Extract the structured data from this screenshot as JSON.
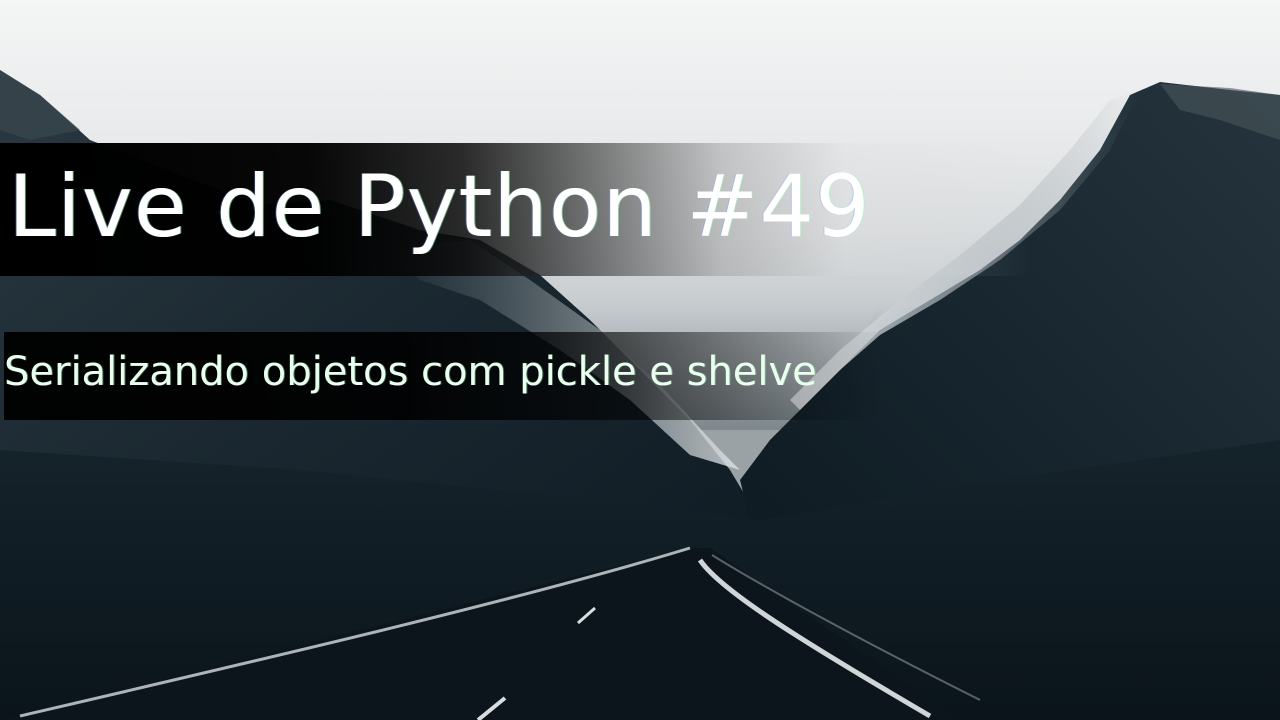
{
  "thumbnail": {
    "title": "Live de Python #49",
    "subtitle": "Serializando objetos com pickle e shelve"
  },
  "colors": {
    "sky": "#eceeef",
    "mountains": "#1b2a33",
    "shadow": "#0e1a22",
    "title_text": "#ffffff",
    "subtitle_text": "#eafff0"
  },
  "background": {
    "scene": "mountain-road-photo"
  }
}
